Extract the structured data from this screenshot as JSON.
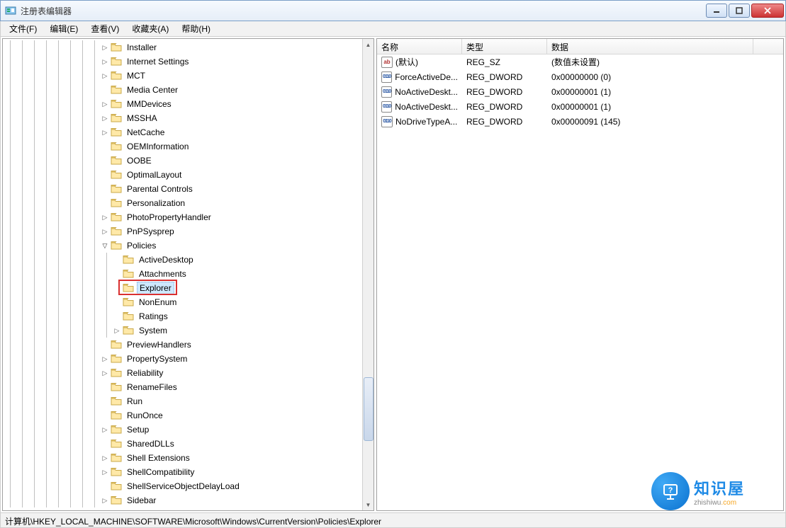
{
  "window": {
    "title": "注册表编辑器"
  },
  "menu": {
    "file": "文件(F)",
    "edit": "编辑(E)",
    "view": "查看(V)",
    "fav": "收藏夹(A)",
    "help": "帮助(H)"
  },
  "tree": {
    "nodes": [
      {
        "label": "Installer",
        "exp": "right",
        "depth": 8
      },
      {
        "label": "Internet Settings",
        "exp": "right",
        "depth": 8
      },
      {
        "label": "MCT",
        "exp": "right",
        "depth": 8
      },
      {
        "label": "Media Center",
        "exp": "none",
        "depth": 8
      },
      {
        "label": "MMDevices",
        "exp": "right",
        "depth": 8
      },
      {
        "label": "MSSHA",
        "exp": "right",
        "depth": 8
      },
      {
        "label": "NetCache",
        "exp": "right",
        "depth": 8
      },
      {
        "label": "OEMInformation",
        "exp": "none",
        "depth": 8
      },
      {
        "label": "OOBE",
        "exp": "none",
        "depth": 8
      },
      {
        "label": "OptimalLayout",
        "exp": "none",
        "depth": 8
      },
      {
        "label": "Parental Controls",
        "exp": "none",
        "depth": 8
      },
      {
        "label": "Personalization",
        "exp": "none",
        "depth": 8
      },
      {
        "label": "PhotoPropertyHandler",
        "exp": "right",
        "depth": 8
      },
      {
        "label": "PnPSysprep",
        "exp": "right",
        "depth": 8
      },
      {
        "label": "Policies",
        "exp": "down",
        "depth": 8
      },
      {
        "label": "ActiveDesktop",
        "exp": "none",
        "depth": 9
      },
      {
        "label": "Attachments",
        "exp": "none",
        "depth": 9
      },
      {
        "label": "Explorer",
        "exp": "none",
        "depth": 9,
        "selected": true,
        "boxed": true
      },
      {
        "label": "NonEnum",
        "exp": "none",
        "depth": 9
      },
      {
        "label": "Ratings",
        "exp": "none",
        "depth": 9
      },
      {
        "label": "System",
        "exp": "right",
        "depth": 9
      },
      {
        "label": "PreviewHandlers",
        "exp": "none",
        "depth": 8
      },
      {
        "label": "PropertySystem",
        "exp": "right",
        "depth": 8
      },
      {
        "label": "Reliability",
        "exp": "right",
        "depth": 8
      },
      {
        "label": "RenameFiles",
        "exp": "none",
        "depth": 8
      },
      {
        "label": "Run",
        "exp": "none",
        "depth": 8
      },
      {
        "label": "RunOnce",
        "exp": "none",
        "depth": 8
      },
      {
        "label": "Setup",
        "exp": "right",
        "depth": 8
      },
      {
        "label": "SharedDLLs",
        "exp": "none",
        "depth": 8
      },
      {
        "label": "Shell Extensions",
        "exp": "right",
        "depth": 8
      },
      {
        "label": "ShellCompatibility",
        "exp": "right",
        "depth": 8
      },
      {
        "label": "ShellServiceObjectDelayLoad",
        "exp": "none",
        "depth": 8
      },
      {
        "label": "Sidebar",
        "exp": "right",
        "depth": 8
      }
    ]
  },
  "list": {
    "headers": {
      "name": "名称",
      "type": "类型",
      "data": "数据"
    },
    "rows": [
      {
        "icon": "str",
        "name": "(默认)",
        "type": "REG_SZ",
        "data": "(数值未设置)"
      },
      {
        "icon": "bin",
        "name": "ForceActiveDe...",
        "type": "REG_DWORD",
        "data": "0x00000000 (0)"
      },
      {
        "icon": "bin",
        "name": "NoActiveDeskt...",
        "type": "REG_DWORD",
        "data": "0x00000001 (1)"
      },
      {
        "icon": "bin",
        "name": "NoActiveDeskt...",
        "type": "REG_DWORD",
        "data": "0x00000001 (1)"
      },
      {
        "icon": "bin",
        "name": "NoDriveTypeA...",
        "type": "REG_DWORD",
        "data": "0x00000091 (145)"
      }
    ]
  },
  "statusbar": {
    "path": "计算机\\HKEY_LOCAL_MACHINE\\SOFTWARE\\Microsoft\\Windows\\CurrentVersion\\Policies\\Explorer"
  },
  "watermark": {
    "big": "知识屋",
    "small_pre": "zhishiwu",
    "small_suf": ".com"
  }
}
